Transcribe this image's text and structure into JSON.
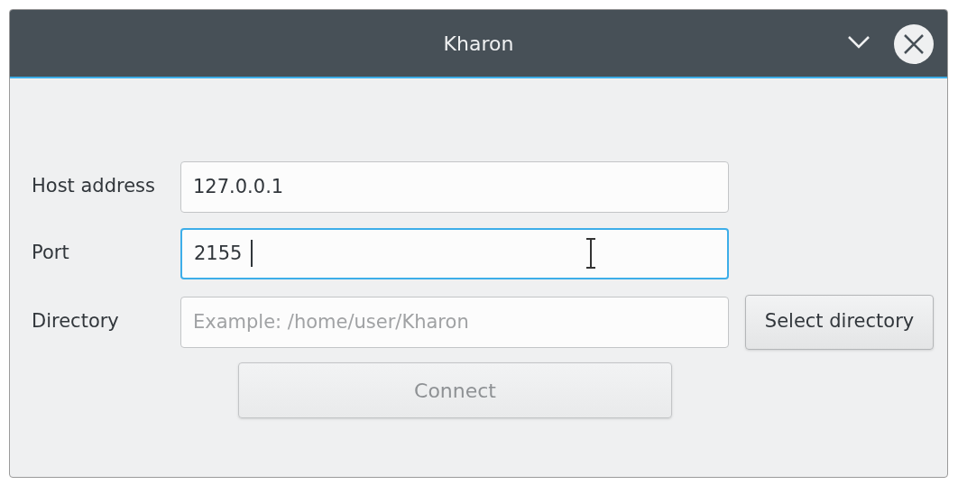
{
  "window": {
    "title": "Kharon"
  },
  "fields": [
    {
      "label": "Host address",
      "value": "127.0.0.1",
      "focused": false
    },
    {
      "label": "Port",
      "value": "2155",
      "focused": true
    },
    {
      "label": "Directory",
      "placeholder": "Example: /home/user/Kharon",
      "focused": false,
      "button": "Select directory"
    }
  ],
  "connect_button": {
    "label": "Connect",
    "disabled": true
  }
}
